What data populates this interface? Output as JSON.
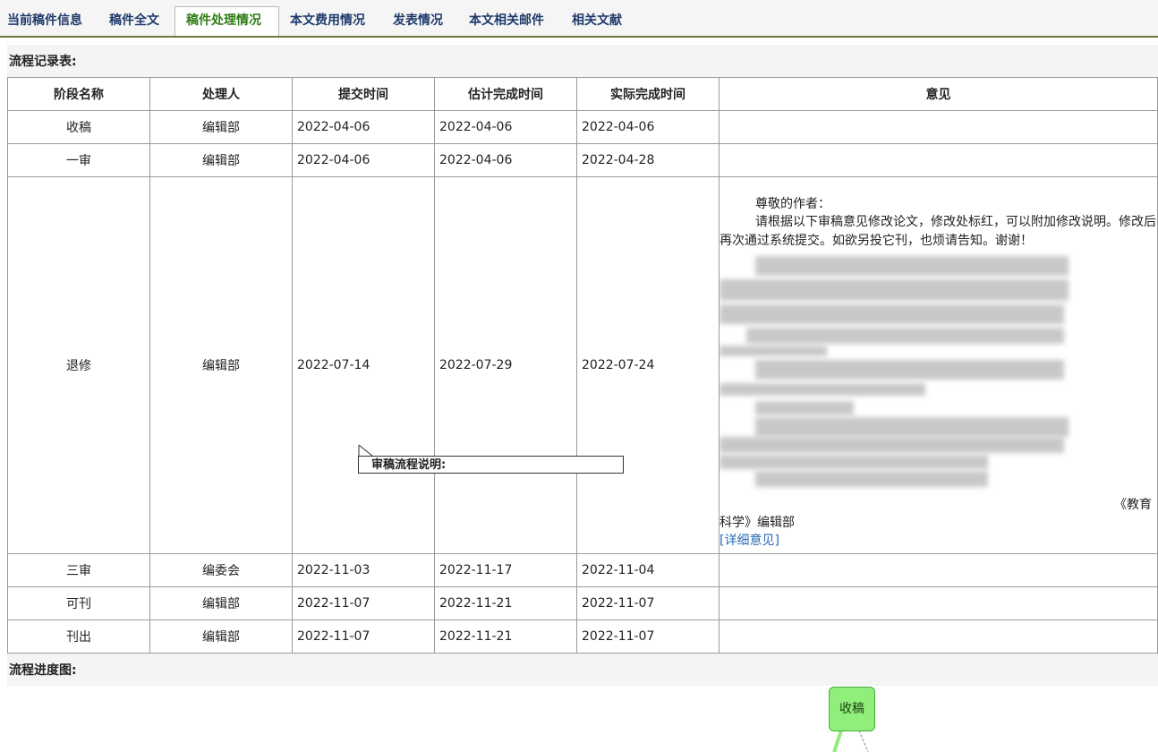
{
  "tabs": [
    {
      "label": "当前稿件信息",
      "active": false
    },
    {
      "label": "稿件全文",
      "active": false
    },
    {
      "label": "稿件处理情况",
      "active": true
    },
    {
      "label": "本文费用情况",
      "active": false
    },
    {
      "label": "发表情况",
      "active": false
    },
    {
      "label": "本文相关邮件",
      "active": false
    },
    {
      "label": "相关文献",
      "active": false
    }
  ],
  "record_section": {
    "title": "流程记录表:"
  },
  "table": {
    "headers": [
      "阶段名称",
      "处理人",
      "提交时间",
      "估计完成时间",
      "实际完成时间",
      "意见"
    ],
    "rows": [
      {
        "stage": "收稿",
        "handler": "编辑部",
        "submit": "2022-04-06",
        "estimate": "2022-04-06",
        "actual": "2022-04-06"
      },
      {
        "stage": "一审",
        "handler": "编辑部",
        "submit": "2022-04-06",
        "estimate": "2022-04-06",
        "actual": "2022-04-28"
      },
      {
        "stage": "退修",
        "handler": "编辑部",
        "submit": "2022-07-14",
        "estimate": "2022-07-29",
        "actual": "2022-07-24"
      },
      {
        "stage": "三审",
        "handler": "编委会",
        "submit": "2022-11-03",
        "estimate": "2022-11-17",
        "actual": "2022-11-04"
      },
      {
        "stage": "可刊",
        "handler": "编辑部",
        "submit": "2022-11-07",
        "estimate": "2022-11-21",
        "actual": "2022-11-07"
      },
      {
        "stage": "刊出",
        "handler": "编辑部",
        "submit": "2022-11-07",
        "estimate": "2022-11-21",
        "actual": "2022-11-07"
      }
    ],
    "opinion": {
      "greeting": "尊敬的作者：",
      "body": "请根据以下审稿意见修改论文，修改处标红，可以附加修改说明。修改后再次通过系统提交。如欲另投它刊，也烦请告知。谢谢！",
      "signature_line1": "《教育",
      "signature_line2": "科学》编辑部",
      "detail_link": "[详细意见]"
    }
  },
  "tooltip": {
    "text": "审稿流程说明:"
  },
  "progress_section": {
    "title": "流程进度图:"
  },
  "diagram": {
    "node_label": "收稿",
    "node_color": "#8fef7a"
  }
}
